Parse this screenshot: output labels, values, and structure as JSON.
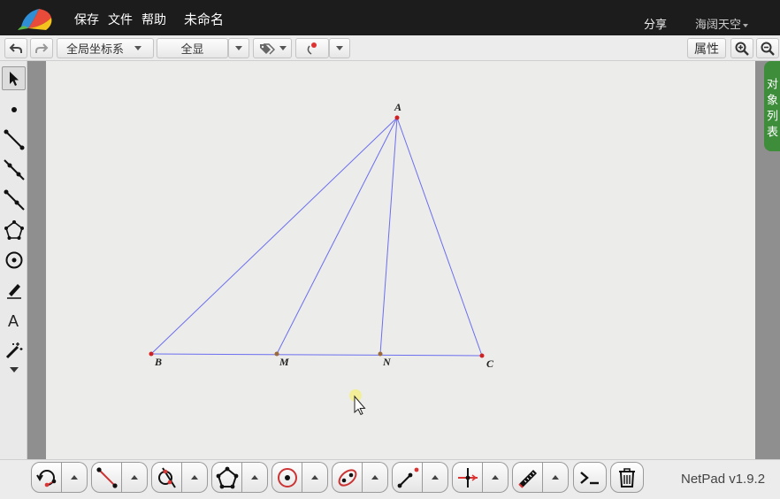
{
  "topbar": {
    "menu": [
      "保存",
      "文件",
      "帮助"
    ],
    "doc_title": "未命名",
    "share": "分享",
    "user": "海阔天空"
  },
  "toolbar": {
    "coord_system": "全局坐标系",
    "view_mode": "全显",
    "properties": "属性"
  },
  "side_tab": "对象列表",
  "colors": {
    "segment": "#6b6ef0",
    "point_red": "#d22020",
    "point_brown": "#9a6a3a",
    "object_tab": "#3d8d3a"
  },
  "figure": {
    "points": [
      {
        "label": "A",
        "kind": "free"
      },
      {
        "label": "B",
        "kind": "free"
      },
      {
        "label": "M",
        "kind": "on-segment"
      },
      {
        "label": "N",
        "kind": "on-segment"
      },
      {
        "label": "C",
        "kind": "free"
      }
    ],
    "segments": [
      "AB",
      "AM",
      "AN",
      "AC",
      "BC"
    ]
  },
  "version": "NetPad v1.9.2"
}
